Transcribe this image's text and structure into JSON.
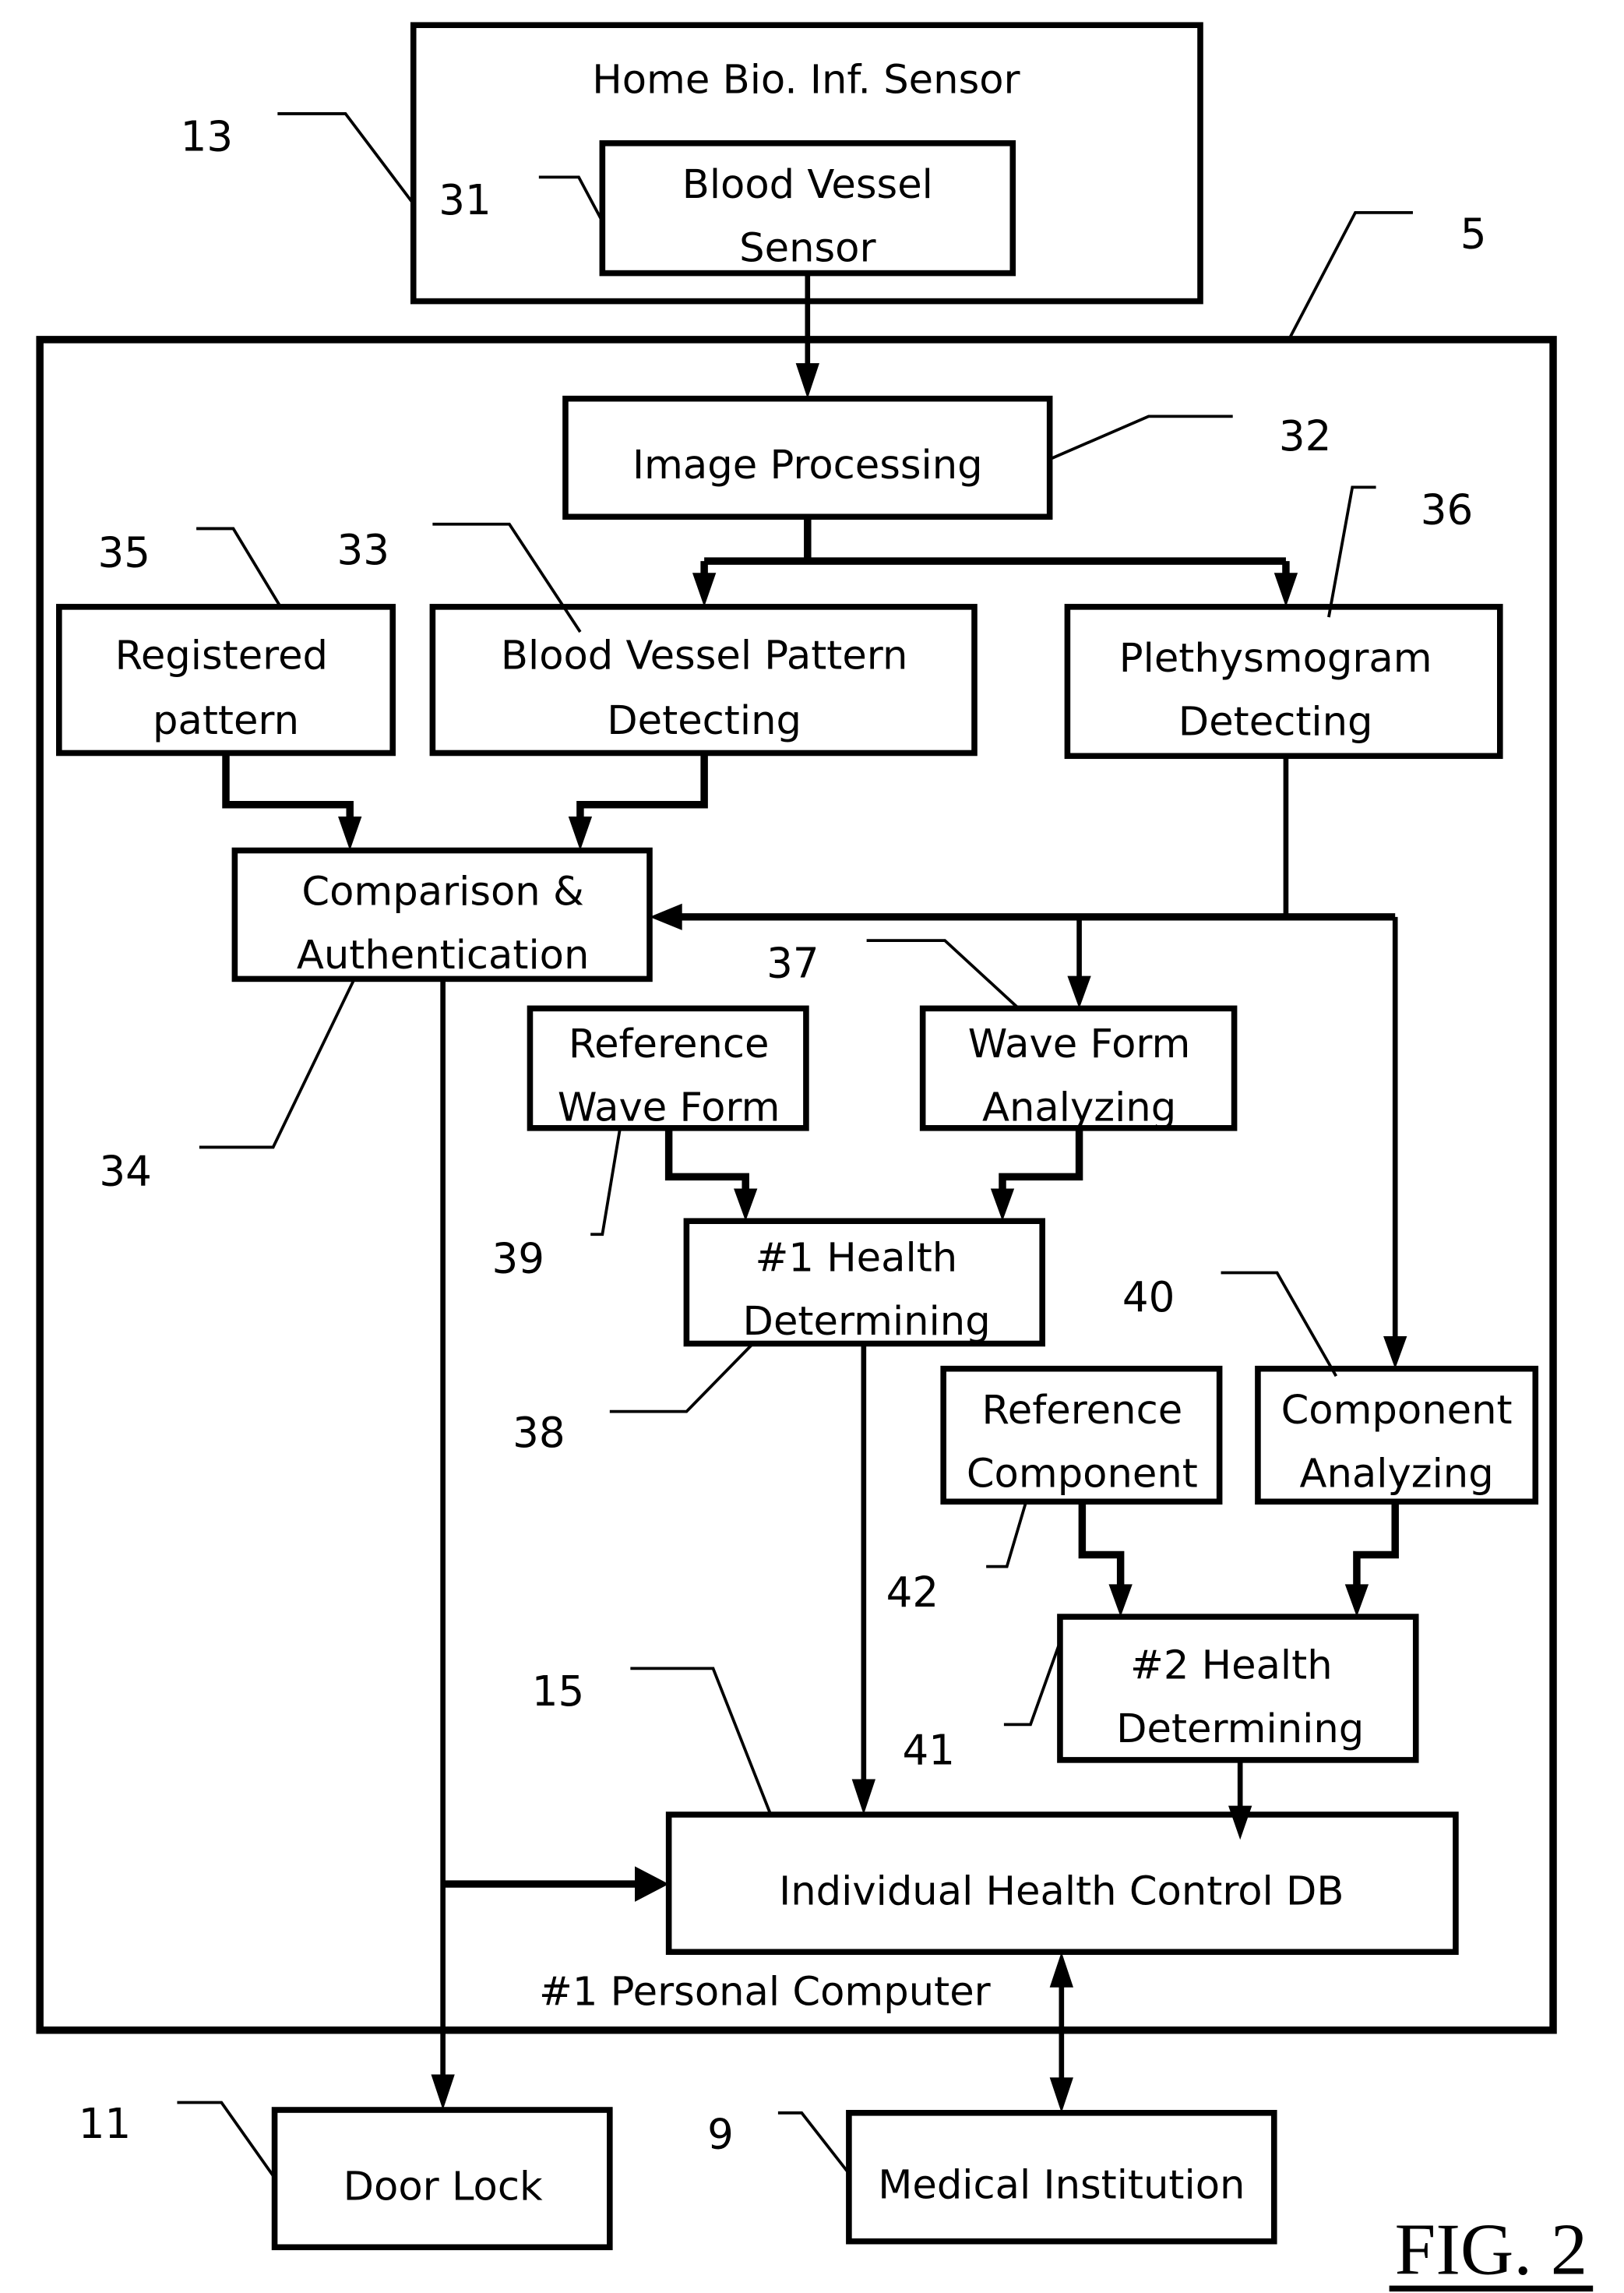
{
  "figure": {
    "label": "FIG. 2"
  },
  "blocks": {
    "home_sensor": {
      "ref": "13",
      "lines": [
        "Home Bio. Inf. Sensor"
      ]
    },
    "blood_vessel_sensor": {
      "ref": "31",
      "lines": [
        "Blood Vessel",
        "Sensor"
      ]
    },
    "personal_computer": {
      "ref": "5",
      "lines": [
        "#1 Personal Computer"
      ]
    },
    "image_processing": {
      "ref": "32",
      "lines": [
        "Image Processing"
      ]
    },
    "registered_pattern": {
      "ref": "35",
      "lines": [
        "Registered",
        "pattern"
      ]
    },
    "bv_pattern_detecting": {
      "ref": "33",
      "lines": [
        "Blood Vessel Pattern",
        "Detecting"
      ]
    },
    "plethysmogram_detecting": {
      "ref": "36",
      "lines": [
        "Plethysmogram",
        "Detecting"
      ]
    },
    "comparison_auth": {
      "ref": "34",
      "lines": [
        "Comparison &",
        "Authentication"
      ]
    },
    "reference_wave_form": {
      "ref": "39",
      "lines": [
        "Reference",
        "Wave Form"
      ]
    },
    "wave_form_analyzing": {
      "ref": "37",
      "lines": [
        "Wave Form",
        "Analyzing"
      ]
    },
    "health_determining_1": {
      "ref": "38",
      "lines": [
        "#1 Health",
        "Determining"
      ]
    },
    "reference_component": {
      "ref": "42",
      "lines": [
        "Reference",
        "Component"
      ]
    },
    "component_analyzing": {
      "ref": "40",
      "lines": [
        "Component",
        "Analyzing"
      ]
    },
    "health_determining_2": {
      "ref": "41",
      "lines": [
        "#2 Health",
        "Determining"
      ]
    },
    "health_control_db": {
      "ref": "15",
      "lines": [
        "Individual Health Control DB"
      ]
    },
    "door_lock": {
      "ref": "11",
      "lines": [
        "Door Lock"
      ]
    },
    "medical_institution": {
      "ref": "9",
      "lines": [
        "Medical Institution"
      ]
    }
  },
  "connections": [
    {
      "from": "blood_vessel_sensor",
      "to": "image_processing",
      "direction": "one-way"
    },
    {
      "from": "image_processing",
      "to": "bv_pattern_detecting",
      "direction": "one-way"
    },
    {
      "from": "image_processing",
      "to": "plethysmogram_detecting",
      "direction": "one-way"
    },
    {
      "from": "registered_pattern",
      "to": "comparison_auth",
      "direction": "one-way"
    },
    {
      "from": "bv_pattern_detecting",
      "to": "comparison_auth",
      "direction": "one-way"
    },
    {
      "from": "plethysmogram_detecting",
      "to": "comparison_auth",
      "direction": "one-way"
    },
    {
      "from": "plethysmogram_detecting",
      "to": "wave_form_analyzing",
      "direction": "one-way"
    },
    {
      "from": "plethysmogram_detecting",
      "to": "component_analyzing",
      "direction": "one-way"
    },
    {
      "from": "reference_wave_form",
      "to": "health_determining_1",
      "direction": "one-way"
    },
    {
      "from": "wave_form_analyzing",
      "to": "health_determining_1",
      "direction": "one-way"
    },
    {
      "from": "reference_component",
      "to": "health_determining_2",
      "direction": "one-way"
    },
    {
      "from": "component_analyzing",
      "to": "health_determining_2",
      "direction": "one-way"
    },
    {
      "from": "health_determining_1",
      "to": "health_control_db",
      "direction": "one-way"
    },
    {
      "from": "health_determining_2",
      "to": "health_control_db",
      "direction": "one-way"
    },
    {
      "from": "comparison_auth",
      "to": "health_control_db",
      "direction": "one-way"
    },
    {
      "from": "comparison_auth",
      "to": "door_lock",
      "direction": "one-way"
    },
    {
      "from": "health_control_db",
      "to": "medical_institution",
      "direction": "two-way"
    }
  ]
}
